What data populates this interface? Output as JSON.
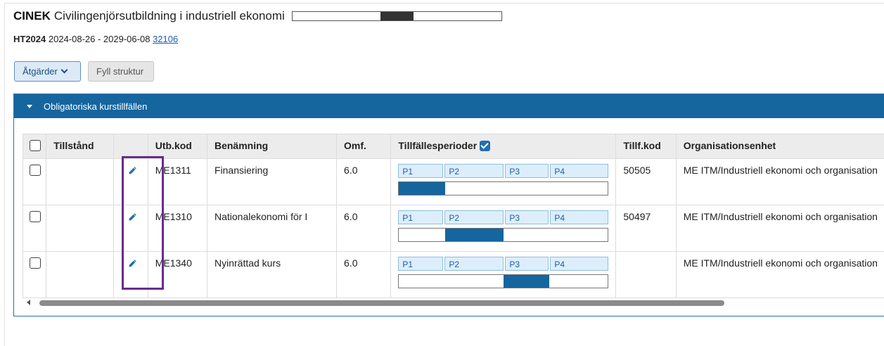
{
  "header": {
    "program_code": "CINEK",
    "program_name": "Civilingenjörsutbildning i industriell ekonomi",
    "progress_fraction_start": 0.42,
    "progress_fraction_end": 0.58
  },
  "subheader": {
    "term": "HT2024",
    "date_range": "2024-08-26 - 2029-06-08",
    "link_text": "32106"
  },
  "toolbar": {
    "actions_label": "Åtgärder",
    "fill_structure_label": "Fyll struktur"
  },
  "panel": {
    "title": "Obligatoriska kurstillfällen"
  },
  "table": {
    "columns": {
      "select": "",
      "state": "Tillstånd",
      "edit": "",
      "code": "Utb.kod",
      "name": "Benämning",
      "credits": "Omf.",
      "periods": "Tillfällesperioder",
      "offering_code": "Tillf.kod",
      "org": "Organisationsenhet"
    },
    "period_labels": [
      "P1",
      "P2",
      "P3",
      "P4"
    ],
    "rows": [
      {
        "state": "",
        "code": "ME1311",
        "name": "Finansiering",
        "credits": "6.0",
        "offering_code": "50505",
        "org": "ME ITM/Industriell ekonomi och organisation",
        "period_span_fraction": [
          0.0,
          0.22
        ]
      },
      {
        "state": "",
        "code": "ME1310",
        "name": "Nationalekonomi för I",
        "credits": "6.0",
        "offering_code": "50497",
        "org": "ME ITM/Industriell ekonomi och organisation",
        "period_span_fraction": [
          0.22,
          0.5
        ]
      },
      {
        "state": "",
        "code": "ME1340",
        "name": "Nyinrättad kurs",
        "credits": "6.0",
        "offering_code": "",
        "org": "ME ITM/Industriell ekonomi och organisation",
        "period_span_fraction": [
          0.5,
          0.72
        ]
      }
    ]
  },
  "colors": {
    "accent": "#15659f",
    "highlight": "#6b2b8c"
  },
  "icons": {
    "edit": "pencil-icon",
    "panel_toggle": "caret-down-icon",
    "actions_dropdown": "chevron-down-icon"
  }
}
